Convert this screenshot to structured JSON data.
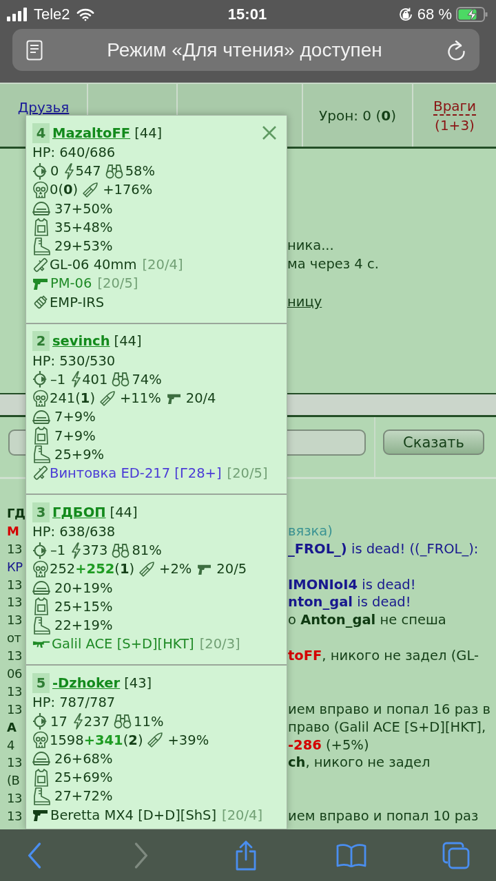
{
  "status_bar": {
    "carrier": "Tele2",
    "time": "15:01",
    "battery": "68 %"
  },
  "address_bar": {
    "text": "Режим «Для чтения» доступен"
  },
  "battle_header": {
    "friends": "Друзья",
    "damage": "Урон: 0 (**0**)",
    "enemies": "Враги",
    "enemies_count": "(1+3)"
  },
  "status_messages": [
    {
      "kind": "text",
      "text": "ника..."
    },
    {
      "kind": "text",
      "text": "ма через 4 с."
    },
    {
      "kind": "link",
      "text": "ницу"
    }
  ],
  "chat": {
    "button": "Сказать"
  },
  "log": [
    {
      "start": {
        "text": "ГД",
        "kind": "bold"
      }
    },
    {
      "start": {
        "text": "M",
        "kind": "enemy"
      },
      "rest": [
        {
          "text": "вязка)",
          "kind": "note"
        }
      ]
    },
    {
      "start": {
        "text": "13",
        "kind": "plain"
      },
      "rest": [
        {
          "text": "_FROL_)",
          "kind": "dead-bold"
        },
        {
          "text": " is dead! ((_FROL_):",
          "kind": "dead"
        }
      ]
    },
    {
      "start": {
        "text": "КР",
        "kind": "dead"
      }
    },
    {
      "start": {
        "text": "13",
        "kind": "plain"
      },
      "rest": [
        {
          "text": "IMONIoI4",
          "kind": "dead-bold"
        },
        {
          "text": " is dead!",
          "kind": "dead"
        }
      ]
    },
    {
      "start": {
        "text": "13",
        "kind": "plain"
      },
      "rest": [
        {
          "text": "nton_gal",
          "kind": "dead-bold"
        },
        {
          "text": " is dead!",
          "kind": "dead"
        }
      ]
    },
    {
      "start": {
        "text": "13",
        "kind": "plain"
      },
      "rest": [
        {
          "text": "о ",
          "kind": "plain"
        },
        {
          "text": "Anton_gal",
          "kind": "bold"
        },
        {
          "text": " не спеша",
          "kind": "plain"
        }
      ]
    },
    {
      "start": {
        "text": "от",
        "kind": "plain"
      }
    },
    {
      "start": {
        "text": "13",
        "kind": "plain"
      },
      "rest": [
        {
          "text": "toFF",
          "kind": "enemy"
        },
        {
          "text": ", никого не задел (GL-",
          "kind": "plain"
        }
      ]
    },
    {
      "start": {
        "text": "06",
        "kind": "plain"
      }
    },
    {
      "start": {
        "text": "13",
        "kind": "plain"
      }
    },
    {
      "start": {
        "text": "13",
        "kind": "plain"
      },
      "rest": [
        {
          "text": "ием вправо и попал 16 раз в",
          "kind": "plain"
        }
      ]
    },
    {
      "start": {
        "text": "A",
        "kind": "bold"
      },
      "rest": [
        {
          "text": "право (Galil ACE [S+D][HKT],",
          "kind": "plain"
        }
      ]
    },
    {
      "start": {
        "text": "4",
        "kind": "plain"
      },
      "rest": [
        {
          "text": "-286",
          "kind": "enemy"
        },
        {
          "text": " (+5%)",
          "kind": "plain"
        }
      ]
    },
    {
      "start": {
        "text": "13",
        "kind": "plain"
      },
      "rest": [
        {
          "text": "ch",
          "kind": "bold"
        },
        {
          "text": ", никого не задел",
          "kind": "plain"
        }
      ]
    },
    {
      "start": {
        "text": "(В",
        "kind": "plain"
      }
    },
    {
      "start": {
        "text": "13",
        "kind": "plain"
      }
    },
    {
      "start": {
        "text": "13",
        "kind": "plain"
      },
      "rest": [
        {
          "text": "ием вправо и попал 10 раз",
          "kind": "plain"
        }
      ]
    }
  ],
  "popup": {
    "players": [
      {
        "number": "4",
        "name": "MazaltoFF",
        "level": "[44]",
        "hp": "HP: 640/686",
        "stats": {
          "crosshair": "0",
          "energy": "547",
          "binoculars": "58%"
        },
        "combat": {
          "kills": {
            "total": "0",
            "streak": "(**0**)"
          },
          "bullet": "+176%"
        },
        "armor": [
          {
            "kind": "helmet",
            "value": "37+50%"
          },
          {
            "kind": "vest",
            "value": "35+48%"
          },
          {
            "kind": "boots",
            "value": "29+53%"
          }
        ],
        "weapons": [
          {
            "kind": "launcher",
            "name": "GL-06 40mm",
            "ammo": "[20/4]",
            "color": "#143f17"
          },
          {
            "kind": "pistol",
            "name": "PM-06",
            "ammo": "[20/5]",
            "color": "#1f8a26"
          },
          {
            "kind": "grenade",
            "name": "EMP-IRS",
            "color": "#143f17"
          }
        ]
      },
      {
        "number": "2",
        "name": "sevinch",
        "level": "[44]",
        "hp": "HP: 530/530",
        "stats": {
          "crosshair": "–1",
          "energy": "401",
          "binoculars": "74%"
        },
        "combat": {
          "kills": {
            "total": "241",
            "streak": "(**1**)"
          },
          "bullet": "+11%",
          "pistol_ammo": "20/4"
        },
        "armor": [
          {
            "kind": "helmet",
            "value": "7+9%"
          },
          {
            "kind": "vest",
            "value": "7+9%"
          },
          {
            "kind": "boots",
            "value": "25+9%"
          }
        ],
        "weapons": [
          {
            "kind": "launcher",
            "name": "Винтовка ED-217 [Г28+]",
            "ammo": "[20/5]",
            "color": "#4a3bd6"
          }
        ]
      },
      {
        "number": "3",
        "name": "ГДБОП",
        "level": "[44]",
        "hp": "HP: 638/638",
        "stats": {
          "crosshair": "–1",
          "energy": "373",
          "binoculars": "81%"
        },
        "combat": {
          "kills": {
            "total": "252",
            "gain": "+252",
            "streak": "(**1**)"
          },
          "bullet": "+2%",
          "pistol_ammo": "20/5"
        },
        "armor": [
          {
            "kind": "helmet",
            "value": "20+19%"
          },
          {
            "kind": "vest",
            "value": "25+15%"
          },
          {
            "kind": "boots",
            "value": "22+19%"
          }
        ],
        "weapons": [
          {
            "kind": "rifle",
            "name": "Galil ACE [S+D][HKT]",
            "ammo": "[20/3]",
            "color": "#1f8a26"
          }
        ]
      },
      {
        "number": "5",
        "name": "-Dzhoker",
        "level": "[43]",
        "hp": "HP: 787/787",
        "stats": {
          "crosshair": "17",
          "energy": "237",
          "binoculars": "11%"
        },
        "combat": {
          "kills": {
            "total": "1598",
            "gain": "+341",
            "streak": "(**2**)"
          },
          "bullet": "+39%"
        },
        "armor": [
          {
            "kind": "helmet",
            "value": "26+68%"
          },
          {
            "kind": "vest",
            "value": "25+69%"
          },
          {
            "kind": "boots",
            "value": "27+72%"
          }
        ],
        "weapons": [
          {
            "kind": "pistol",
            "name": "Beretta MX4 [D+D][ShS]",
            "ammo": "[20/4]",
            "color": "#143f17"
          }
        ]
      }
    ]
  },
  "toolbar": {
    "buttons": [
      {
        "kind": "back",
        "disabled": false
      },
      {
        "kind": "forward",
        "disabled": true
      },
      {
        "kind": "share",
        "disabled": false
      },
      {
        "kind": "bookmarks",
        "disabled": false
      },
      {
        "kind": "tabs",
        "disabled": false
      }
    ]
  }
}
